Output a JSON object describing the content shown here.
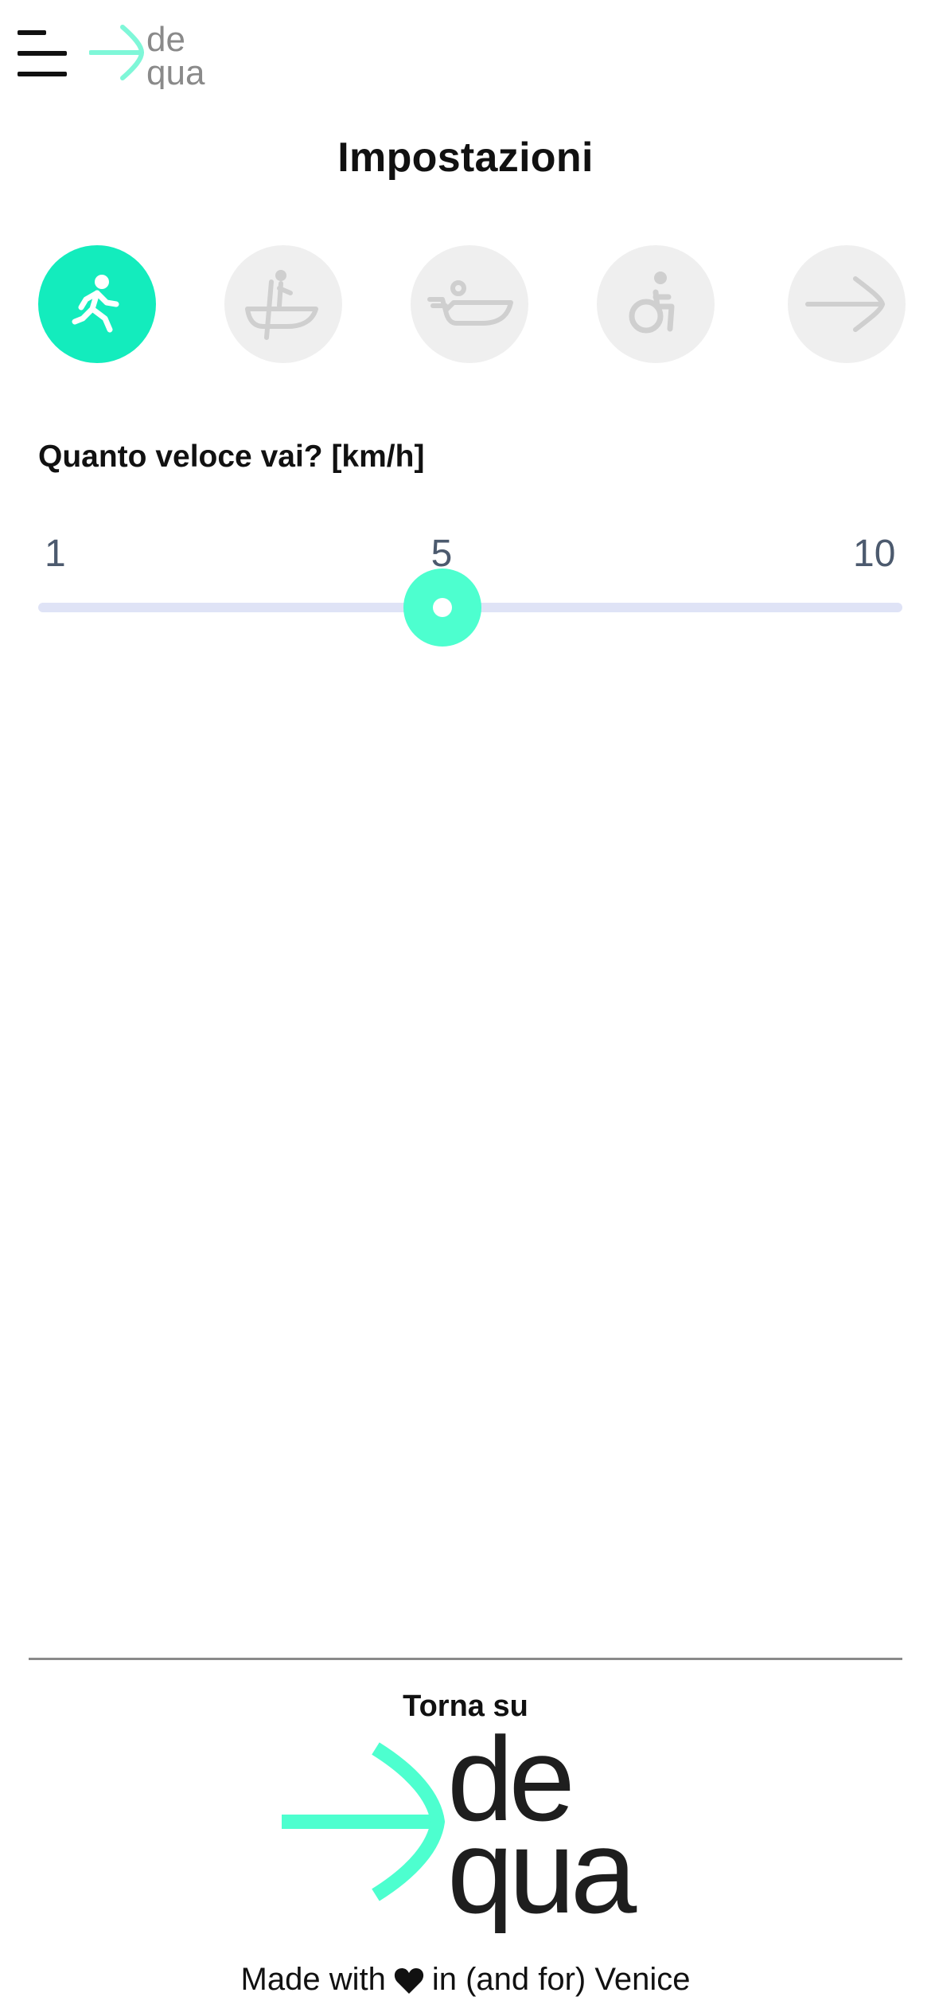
{
  "header": {
    "logo_text_top": "de",
    "logo_text_bottom": "qua"
  },
  "page": {
    "title": "Impostazioni"
  },
  "modes": [
    {
      "icon": "walking-icon",
      "active": true
    },
    {
      "icon": "rowing-boat-icon",
      "active": false
    },
    {
      "icon": "motor-boat-icon",
      "active": false
    },
    {
      "icon": "wheelchair-icon",
      "active": false
    },
    {
      "icon": "arrow-right-icon",
      "active": false
    }
  ],
  "speed": {
    "label": "Quanto veloce vai? [km/h]",
    "min_label": "1",
    "current_label": "5",
    "max_label": "10",
    "min": 1,
    "max": 10,
    "value": 5
  },
  "footer": {
    "back_to_top": "Torna su",
    "logo_text_top": "de",
    "logo_text_bottom": "qua",
    "made_with_prefix": "Made with",
    "made_with_suffix": "in (and for) Venice"
  },
  "colors": {
    "accent": "#13ecbd",
    "slider_thumb": "#4dffcf",
    "inactive_mode_bg": "#efefef",
    "inactive_icon": "#cfcfcf",
    "track": "#dfe3f6",
    "tick_text": "#4c5a6e"
  }
}
